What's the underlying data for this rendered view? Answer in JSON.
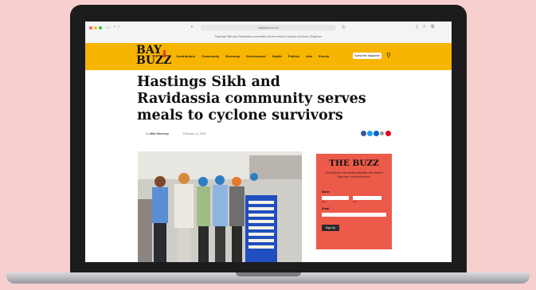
{
  "browser": {
    "url": "baybuzz.co.nz",
    "tab_title": "Hastings Sikh and Ravidassia community serves meals to cyclone survivors | BayBuzz"
  },
  "site": {
    "logo_line1": "BAY",
    "logo_line2": "BUZZ",
    "nav_items": [
      "Contributors",
      "Community",
      "Economy",
      "Environment",
      "Health",
      "Politics",
      "Arts",
      "Events"
    ],
    "subscribe_label": "Subscribe Magazine"
  },
  "article": {
    "headline": "Hastings Sikh and Ravidassia community serves meals to cyclone survivors",
    "byline_prefix": "By",
    "author": "Mike Sweeney",
    "date": "February 14, 2023",
    "share_icons": [
      "facebook-icon",
      "twitter-icon",
      "linkedin-icon",
      "email-icon",
      "pinterest-icon"
    ]
  },
  "sidebar": {
    "title": "THE BUZZ",
    "description": "Get BayBuzz's free weekly newsletter with Hawke's Bay news, views and stories.",
    "name_label": "Name",
    "first_hint": "First",
    "last_hint": "Last",
    "email_label": "Email",
    "signup_label": "Sign Up"
  },
  "colors": {
    "header": "#f7b500",
    "sidebar": "#ec5a4a",
    "background": "#f8cfcf"
  }
}
